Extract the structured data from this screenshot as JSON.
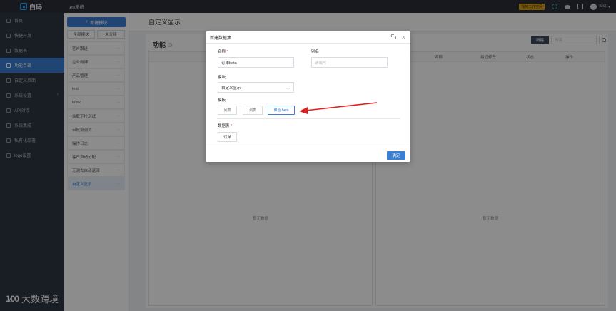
{
  "topbar": {
    "logo_text": "白码",
    "system_name": "test系统",
    "badge": "我的工作空间",
    "user": "test"
  },
  "nav": {
    "items": [
      {
        "label": "首页",
        "icon": "home-icon"
      },
      {
        "label": "快捷开发",
        "icon": "lightning-icon"
      },
      {
        "label": "数据表",
        "icon": "table-icon"
      },
      {
        "label": "功能目录",
        "icon": "folder-icon",
        "active": true
      },
      {
        "label": "自定义页面",
        "icon": "page-icon"
      },
      {
        "label": "系统设置",
        "icon": "settings-icon",
        "has_chevron": true
      },
      {
        "label": "API对接",
        "icon": "api-icon"
      },
      {
        "label": "系统集成",
        "icon": "integration-icon"
      },
      {
        "label": "私有化部署",
        "icon": "server-icon"
      },
      {
        "label": "logo设置",
        "icon": "image-icon"
      }
    ],
    "brand_bottom": "大数跨境",
    "brand_mark": "1⁄00"
  },
  "modules": {
    "new_button": "新建模块",
    "tabs": [
      "全部模块",
      "未分组"
    ],
    "items": [
      {
        "label": "客户跟进"
      },
      {
        "label": "企业微博"
      },
      {
        "label": "产品管理"
      },
      {
        "label": "test"
      },
      {
        "label": "test2"
      },
      {
        "label": "关联下拉测试"
      },
      {
        "label": "审批流测试"
      },
      {
        "label": "操作日志"
      },
      {
        "label": "客户自动分配"
      },
      {
        "label": "无测去自动返回"
      },
      {
        "label": "自定义显示",
        "active": true
      }
    ],
    "more": "···"
  },
  "main": {
    "page_title": "自定义显示",
    "func_title": "功能",
    "new_button": "新建",
    "search_placeholder": "搜索...",
    "columns": [
      "名称",
      "最近修改",
      "状态",
      "操作"
    ],
    "empty_left": "暂无数据",
    "empty_right": "暂无数据"
  },
  "dialog": {
    "title": "新建数据集",
    "name_label": "名称",
    "name_value": "订单beta",
    "alias_label": "别名",
    "alias_placeholder": "请填写",
    "module_label": "模块",
    "module_value": "自定义显示",
    "template_label": "模板",
    "templates": [
      "列表",
      "列表",
      "聚合 beta"
    ],
    "selected_template": 2,
    "dataset_label": "数据表",
    "dataset_value": "订单",
    "ok": "确定"
  },
  "colors": {
    "accent": "#3b7fd3",
    "sidebar": "#2f3542",
    "topbar": "#2b2f3a",
    "arrow": "#e02020",
    "badge": "#d9a21b"
  }
}
